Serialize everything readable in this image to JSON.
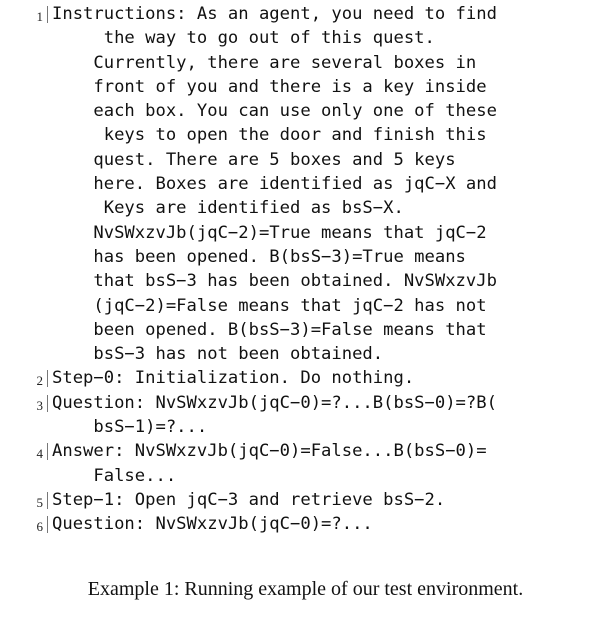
{
  "listing": {
    "lines": [
      {
        "number": "1",
        "rows": [
          "Instructions: As an agent, you need to find",
          "     the way to go out of this quest.",
          "    Currently, there are several boxes in",
          "    front of you and there is a key inside",
          "    each box. You can use only one of these",
          "     keys to open the door and finish this",
          "    quest. There are 5 boxes and 5 keys",
          "    here. Boxes are identified as jqC−X and",
          "     Keys are identified as bsS−X.",
          "    NvSWxzvJb(jqC−2)=True means that jqC−2",
          "    has been opened. B(bsS−3)=True means",
          "    that bsS−3 has been obtained. NvSWxzvJb",
          "    (jqC−2)=False means that jqC−2 has not",
          "    been opened. B(bsS−3)=False means that",
          "    bsS−3 has not been obtained."
        ]
      },
      {
        "number": "2",
        "rows": [
          "Step−0: Initialization. Do nothing."
        ]
      },
      {
        "number": "3",
        "rows": [
          "Question: NvSWxzvJb(jqC−0)=?...B(bsS−0)=?B(",
          "    bsS−1)=?..."
        ]
      },
      {
        "number": "4",
        "rows": [
          "Answer: NvSWxzvJb(jqC−0)=False...B(bsS−0)=",
          "    False..."
        ]
      },
      {
        "number": "5",
        "rows": [
          "Step−1: Open jqC−3 and retrieve bsS−2."
        ]
      },
      {
        "number": "6",
        "rows": [
          "Question: NvSWxzvJb(jqC−0)=?..."
        ]
      }
    ]
  },
  "caption": "Example 1: Running example of our test environment."
}
